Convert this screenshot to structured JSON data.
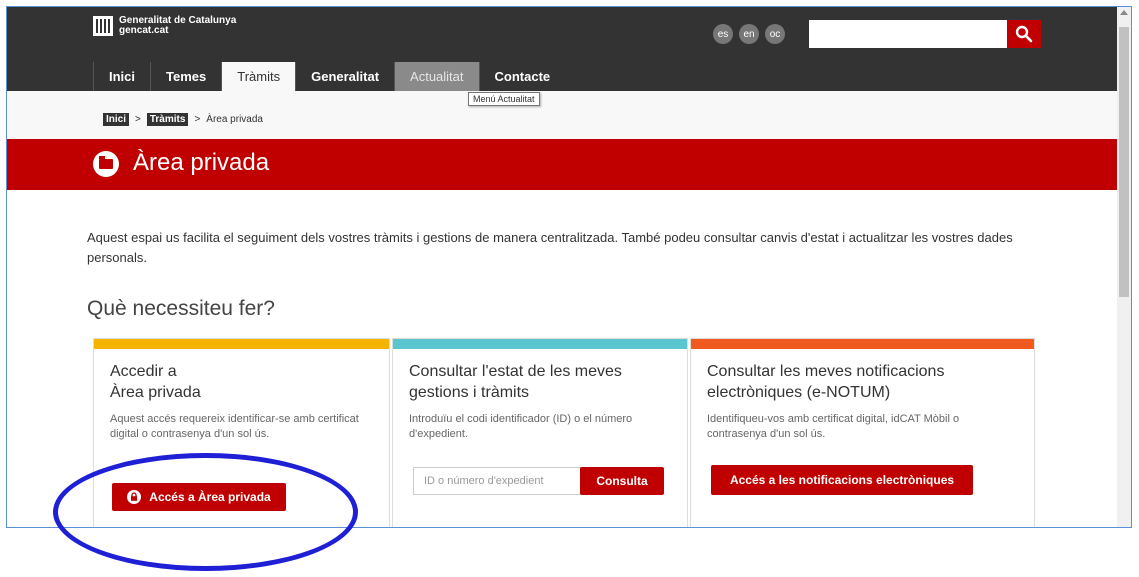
{
  "header": {
    "logo_line1": "Generalitat de Catalunya",
    "logo_line2": "gencat.cat",
    "languages": [
      "es",
      "en",
      "oc"
    ],
    "search_placeholder": "",
    "search_icon": "search-icon"
  },
  "nav": {
    "items": [
      "Inici",
      "Temes",
      "Tràmits",
      "Generalitat",
      "Actualitat",
      "Contacte"
    ],
    "active": "Tràmits",
    "hovered": "Actualitat",
    "tooltip": "Menú Actualitat"
  },
  "breadcrumb": {
    "items": [
      "Inici",
      "Tràmits",
      "Àrea privada"
    ],
    "separator": ">"
  },
  "banner": {
    "title": "Àrea privada",
    "icon": "folder-icon",
    "color": "#c00000"
  },
  "main": {
    "intro": "Aquest espai us facilita el seguiment dels vostres tràmits i gestions de manera centralitzada. També podeu consultar canvis d'estat i actualitzar les vostres dades personals.",
    "question": "Què necessiteu fer?"
  },
  "cards": [
    {
      "title_line1": "Accedir a",
      "title_line2": "Àrea privada",
      "desc": "Aquest accés requereix identificar-se amb certificat digital o contrasenya d'un sol ús.",
      "button": "Accés a Àrea privada",
      "button_icon": "lock-icon",
      "accent": "#f5b400"
    },
    {
      "title_line1": "Consultar l'estat de les meves",
      "title_line2": "gestions i tràmits",
      "desc": "Introduïu el codi identificador (ID) o el número d'expedient.",
      "input_placeholder": "ID o número d'expedient",
      "button": "Consulta",
      "accent": "#5bc6d0"
    },
    {
      "title_line1": "Consultar les meves notificacions",
      "title_line2": "electròniques (e-NOTUM)",
      "desc": "Identifiqueu-vos amb certificat digital, idCAT Mòbil o contrasenya d'un sol ús.",
      "button": "Accés a les notificacions electròniques",
      "accent": "#f05a1e"
    }
  ],
  "annotation": {
    "color": "#1f1fd6"
  }
}
